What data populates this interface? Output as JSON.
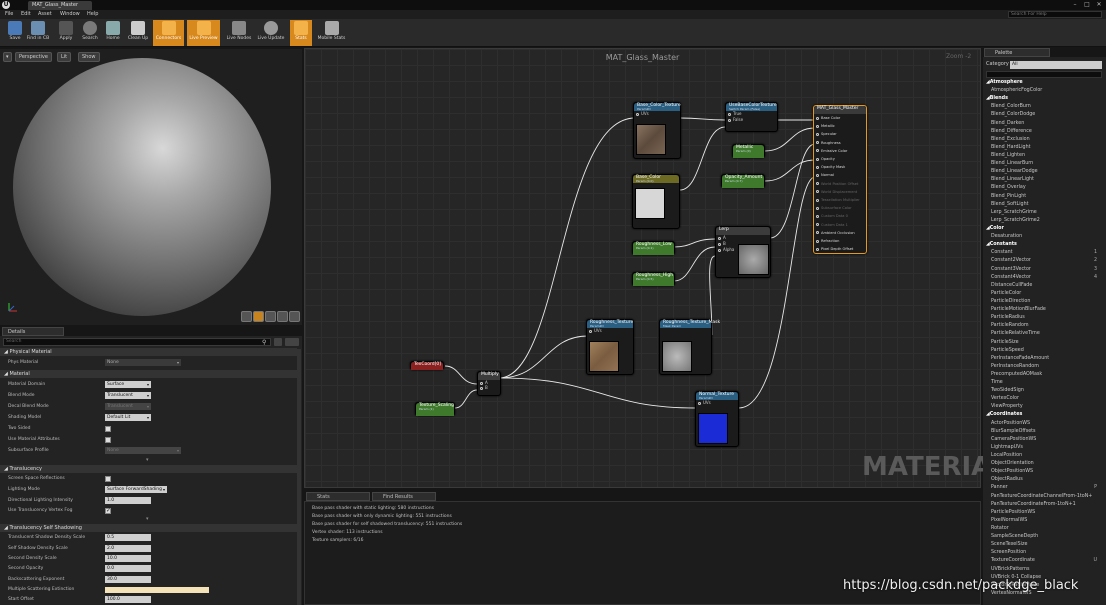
{
  "window": {
    "doc_tab": "MAT_Glass_Master",
    "minimize": "–",
    "maximize": "□",
    "close": "✕"
  },
  "menu": [
    "File",
    "Edit",
    "Asset",
    "Window",
    "Help"
  ],
  "help_search": {
    "placeholder": "Search For Help"
  },
  "toolbar": [
    {
      "label": "Save",
      "icon": "save-icon",
      "active": false
    },
    {
      "label": "Find in CB",
      "icon": "find-in-cb-icon",
      "active": false
    },
    {
      "label": "Apply",
      "icon": "apply-icon",
      "active": false
    },
    {
      "label": "Search",
      "icon": "search-icon",
      "active": false
    },
    {
      "label": "Home",
      "icon": "home-icon",
      "active": false
    },
    {
      "label": "Clean Up",
      "icon": "clean-up-icon",
      "active": false
    },
    {
      "label": "Connectors",
      "icon": "connectors-icon",
      "active": true
    },
    {
      "label": "Live Preview",
      "icon": "live-preview-icon",
      "active": true
    },
    {
      "label": "Live Nodes",
      "icon": "live-nodes-icon",
      "active": false
    },
    {
      "label": "Live Update",
      "icon": "live-update-icon",
      "active": false
    },
    {
      "label": "Stats",
      "icon": "stats-icon",
      "active": true
    },
    {
      "label": "Mobile Stats",
      "icon": "mobile-stats-icon",
      "active": false
    }
  ],
  "viewport": {
    "perspective": "Perspective",
    "lit": "Lit",
    "show": "Show"
  },
  "details": {
    "tab": "Details",
    "search_placeholder": "Search",
    "sections": {
      "physical_material": "Physical Material",
      "material": "Material",
      "translucency": "Translucency",
      "translucency_self_shadowing": "Translucency Self Shadowing"
    },
    "rows": {
      "phys_material": {
        "label": "Phys Material",
        "value": "None"
      },
      "material_domain": {
        "label": "Material Domain",
        "value": "Surface"
      },
      "blend_mode": {
        "label": "Blend Mode",
        "value": "Translucent"
      },
      "decal_blend_mode": {
        "label": "Decal Blend Mode",
        "value": "Translucent"
      },
      "shading_model": {
        "label": "Shading Model",
        "value": "Default Lit"
      },
      "two_sided": {
        "label": "Two Sided",
        "checked": false
      },
      "use_material_attributes": {
        "label": "Use Material Attributes",
        "checked": false
      },
      "subsurface_profile": {
        "label": "Subsurface Profile",
        "value": "None"
      },
      "screen_space_reflections": {
        "label": "Screen Space Reflections",
        "checked": false
      },
      "lighting_mode": {
        "label": "Lighting Mode",
        "value": "Surface ForwardShading"
      },
      "directional_lighting_intensity": {
        "label": "Directional Lighting Intensity",
        "value": "1.0"
      },
      "use_translucency_vertex_fog": {
        "label": "Use Translucency Vertex Fog",
        "checked": true
      },
      "shadow_density_scale": {
        "label": "Translucent Shadow Density Scale",
        "value": "0.5"
      },
      "self_shadow_density_scale": {
        "label": "Self Shadow Density Scale",
        "value": "2.0"
      },
      "second_density_scale": {
        "label": "Second Density Scale",
        "value": "10.0"
      },
      "second_opacity": {
        "label": "Second Opacity",
        "value": "0.0"
      },
      "backscattering_exponent": {
        "label": "Backscattering Exponent",
        "value": "30.0"
      },
      "multiple_scattering_extinction": {
        "label": "Multiple Scattering Extinction",
        "value": ""
      },
      "start_offset": {
        "label": "Start Offset",
        "value": "100.0"
      }
    }
  },
  "graph": {
    "title": "MAT_Glass_Master",
    "zoom": "Zoom -2",
    "watermark": "MATERIAL",
    "nodes": {
      "base_color_texture": {
        "title": "Base_Color_Texture",
        "sub": "Param2D",
        "pin": "UVs"
      },
      "base_color": {
        "title": "Base_Color",
        "sub": "Param (0.0)"
      },
      "roughness_low": {
        "title": "Roughness_Low",
        "sub": "Param (0.1)"
      },
      "roughness_high": {
        "title": "Roughness_High",
        "sub": "Param (0.5)"
      },
      "use_base_color_texture": {
        "title": "UseBaseColorTexture",
        "sub": "Switch Param (False)",
        "pin_true": "True",
        "pin_false": "False"
      },
      "metallic": {
        "title": "Metallic",
        "sub": "Param (0)"
      },
      "opacity_amount": {
        "title": "Opacity_Amount",
        "sub": "Param (0.7)"
      },
      "lerp": {
        "title": "Lerp",
        "pin_a": "A",
        "pin_b": "B",
        "pin_alpha": "Alpha"
      },
      "mat_glass_master": {
        "title": "MAT_Glass_Master",
        "pins": [
          "Base Color",
          "Metallic",
          "Specular",
          "Roughness",
          "Emissive Color",
          "Opacity",
          "Opacity Mask",
          "Normal",
          "World Position Offset",
          "World Displacement",
          "Tessellation Multiplier",
          "Subsurface Color",
          "Custom Data 0",
          "Custom Data 1",
          "Ambient Occlusion",
          "Refraction",
          "Pixel Depth Offset"
        ]
      },
      "tex_coord": {
        "title": "TexCoord[0]"
      },
      "texture_scaling": {
        "title": "Texture_Scaling",
        "sub": "Param (1)"
      },
      "multiply": {
        "title": "Multiply",
        "pin_a": "A",
        "pin_b": "B"
      },
      "roughness_texture": {
        "title": "Roughness_Texture",
        "sub": "Param2D",
        "pin": "UVs"
      },
      "roughness_texture_mask": {
        "title": "Roughness_Texture_Mask",
        "sub": "Mask Param"
      },
      "normal_texture": {
        "title": "Normal_Texture",
        "sub": "Param2D",
        "pin": "UVs"
      }
    }
  },
  "stats": {
    "tabs": [
      "Stats",
      "Find Results"
    ],
    "lines": [
      "Base pass shader with static lighting: 580 instructions",
      "Base pass shader with only dynamic lighting: 551 instructions",
      "Base pass shader for self shadowed translucency: 551 instructions",
      "Vertex shader: 113 instructions",
      "Texture samplers: 6/16"
    ]
  },
  "palette": {
    "tab": "Palette",
    "category_label": "Category",
    "category_value": "All",
    "items": [
      {
        "t": "Atmosphere",
        "cat": true
      },
      {
        "t": "AtmosphericFogColor"
      },
      {
        "t": "Blends",
        "cat": true
      },
      {
        "t": "Blend_ColorBurn"
      },
      {
        "t": "Blend_ColorDodge"
      },
      {
        "t": "Blend_Darken"
      },
      {
        "t": "Blend_Difference"
      },
      {
        "t": "Blend_Exclusion"
      },
      {
        "t": "Blend_HardLight"
      },
      {
        "t": "Blend_Lighten"
      },
      {
        "t": "Blend_LinearBurn"
      },
      {
        "t": "Blend_LinearDodge"
      },
      {
        "t": "Blend_LinearLight"
      },
      {
        "t": "Blend_Overlay"
      },
      {
        "t": "Blend_PinLight"
      },
      {
        "t": "Blend_SoftLight"
      },
      {
        "t": "Lerp_ScratchGrime"
      },
      {
        "t": "Lerp_ScratchGrime2"
      },
      {
        "t": "Color",
        "cat": true
      },
      {
        "t": "Desaturation"
      },
      {
        "t": "Constants",
        "cat": true
      },
      {
        "t": "Constant",
        "hk": "1"
      },
      {
        "t": "Constant2Vector",
        "hk": "2"
      },
      {
        "t": "Constant3Vector",
        "hk": "3"
      },
      {
        "t": "Constant4Vector",
        "hk": "4"
      },
      {
        "t": "DistanceCullFade"
      },
      {
        "t": "ParticleColor"
      },
      {
        "t": "ParticleDirection"
      },
      {
        "t": "ParticleMotionBlurFade"
      },
      {
        "t": "ParticleRadius"
      },
      {
        "t": "ParticleRandom"
      },
      {
        "t": "ParticleRelativeTime"
      },
      {
        "t": "ParticleSize"
      },
      {
        "t": "ParticleSpeed"
      },
      {
        "t": "PerInstanceFadeAmount"
      },
      {
        "t": "PerInstanceRandom"
      },
      {
        "t": "PrecomputedAOMask"
      },
      {
        "t": "Time"
      },
      {
        "t": "TwoSidedSign"
      },
      {
        "t": "VertexColor"
      },
      {
        "t": "ViewProperty"
      },
      {
        "t": "Coordinates",
        "cat": true
      },
      {
        "t": "ActorPositionWS"
      },
      {
        "t": "BlurSampleOffsets"
      },
      {
        "t": "CameraPositionWS"
      },
      {
        "t": "LightmapUVs"
      },
      {
        "t": "LocalPosition"
      },
      {
        "t": "ObjectOrientation"
      },
      {
        "t": "ObjectPositionWS"
      },
      {
        "t": "ObjectRadius"
      },
      {
        "t": "Panner",
        "hk": "P"
      },
      {
        "t": "PanTextureCoordinateChannelFrom-1toN+"
      },
      {
        "t": "PanTextureCoordinateFrom-1toN+1"
      },
      {
        "t": "ParticlePositionWS"
      },
      {
        "t": "PixelNormalWS"
      },
      {
        "t": "Rotator"
      },
      {
        "t": "SampleSceneDepth"
      },
      {
        "t": "SceneTexelSize"
      },
      {
        "t": "ScreenPosition"
      },
      {
        "t": "TextureCoordinate",
        "hk": "U"
      },
      {
        "t": "UVBrickPatterns"
      },
      {
        "t": "UVBrick 0-1 Collapse"
      },
      {
        "t": "VectorToRadialValue"
      },
      {
        "t": "VertexNormalWS"
      }
    ]
  },
  "watermark_url": "https://blog.csdn.net/packdge_black"
}
